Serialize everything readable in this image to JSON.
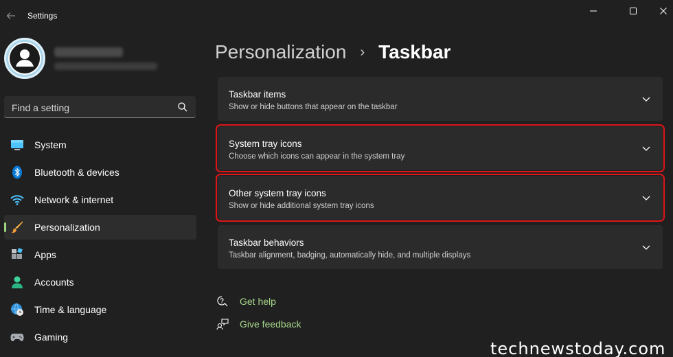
{
  "app": {
    "title": "Settings"
  },
  "sidebar": {
    "search_placeholder": "Find a setting",
    "items": [
      {
        "label": "System",
        "icon": "monitor-icon"
      },
      {
        "label": "Bluetooth & devices",
        "icon": "bluetooth-icon"
      },
      {
        "label": "Network & internet",
        "icon": "wifi-icon"
      },
      {
        "label": "Personalization",
        "icon": "brush-icon",
        "active": true
      },
      {
        "label": "Apps",
        "icon": "apps-icon"
      },
      {
        "label": "Accounts",
        "icon": "person-icon"
      },
      {
        "label": "Time & language",
        "icon": "globe-clock-icon"
      },
      {
        "label": "Gaming",
        "icon": "gamepad-icon"
      }
    ]
  },
  "main": {
    "breadcrumb": {
      "parent": "Personalization",
      "separator": "›",
      "current": "Taskbar"
    },
    "cards": [
      {
        "title": "Taskbar items",
        "desc": "Show or hide buttons that appear on the taskbar",
        "highlight": false
      },
      {
        "title": "System tray icons",
        "desc": "Choose which icons can appear in the system tray",
        "highlight": true
      },
      {
        "title": "Other system tray icons",
        "desc": "Show or hide additional system tray icons",
        "highlight": true
      },
      {
        "title": "Taskbar behaviors",
        "desc": "Taskbar alignment, badging, automatically hide, and multiple displays",
        "highlight": false
      }
    ],
    "links": [
      {
        "label": "Get help",
        "icon": "help-icon"
      },
      {
        "label": "Give feedback",
        "icon": "feedback-icon"
      }
    ]
  },
  "watermark": "technewstoday.com",
  "colors": {
    "accent": "#a9d88c",
    "highlight_border": "#e0161a",
    "background": "#202020",
    "card": "#2b2b2b"
  }
}
